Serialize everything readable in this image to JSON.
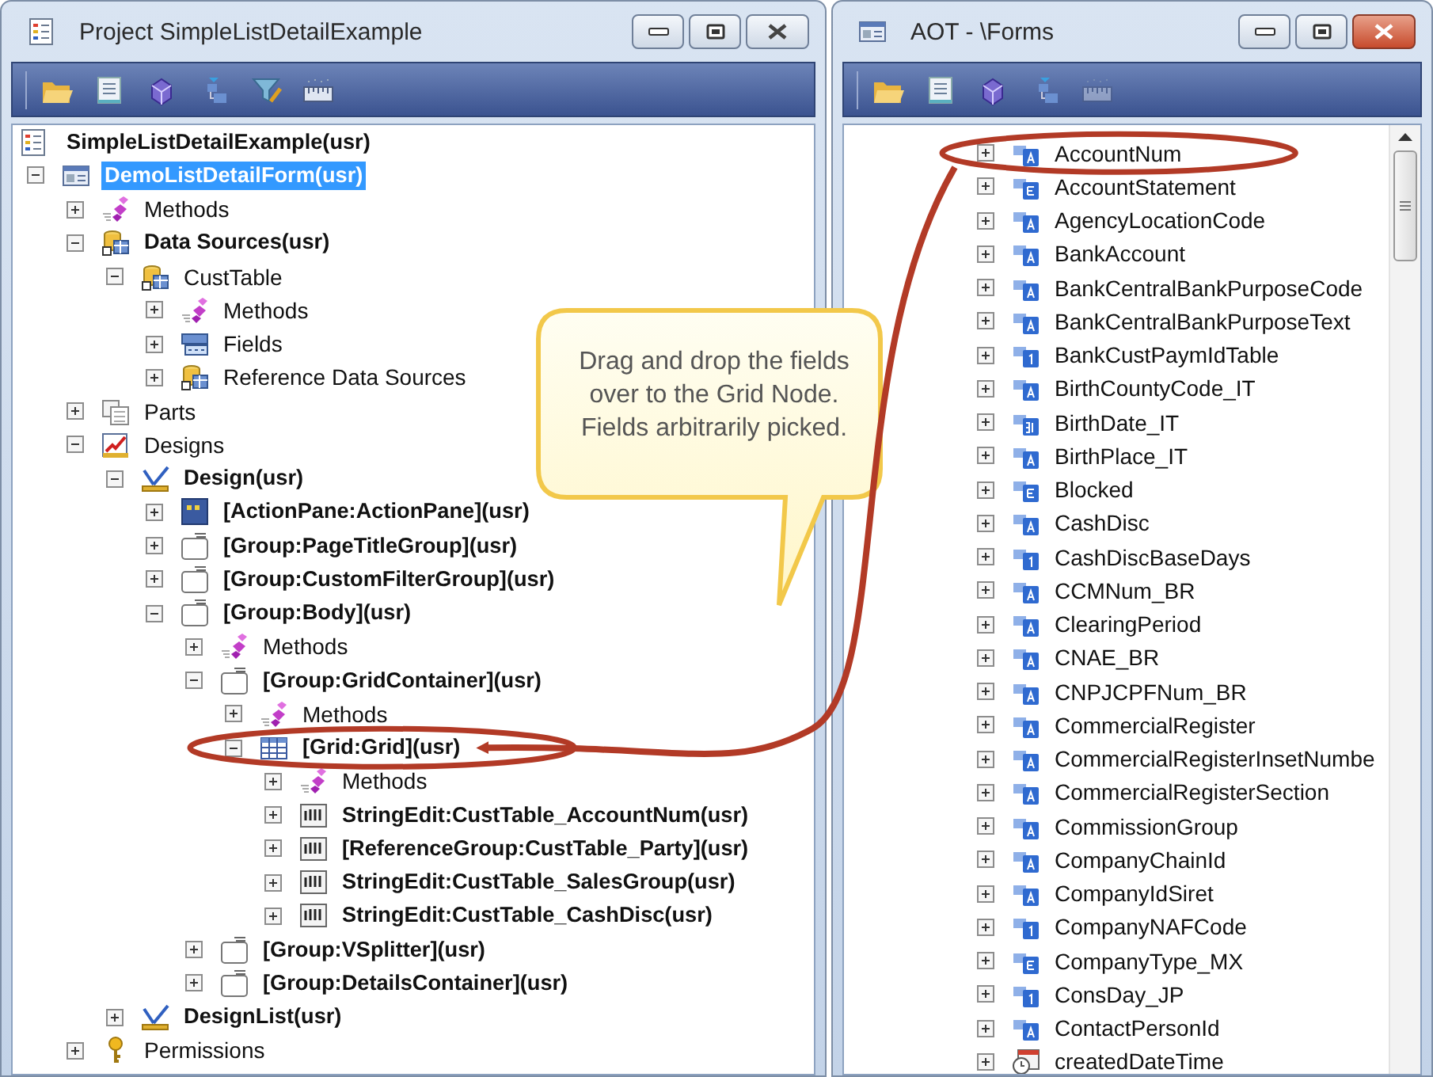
{
  "windows": [
    {
      "kind": "project",
      "title": "Project SimpleListDetailExample",
      "active": false,
      "toolbar": [
        {
          "kind": "open",
          "disabled": false
        },
        {
          "kind": "properties",
          "disabled": false
        },
        {
          "kind": "compile",
          "disabled": false
        },
        {
          "kind": "tree",
          "disabled": false
        },
        {
          "kind": "filter",
          "disabled": false
        },
        {
          "kind": "grid",
          "disabled": false
        }
      ],
      "tree": [
        {
          "text": "SimpleListDetailExample(usr)",
          "kind": "project",
          "bold": true,
          "selected": false,
          "highlighted": false,
          "children": [
            {
              "text": "DemoListDetailForm(usr)",
              "kind": "form",
              "bold": true,
              "expanded": true,
              "selected": true,
              "highlighted": false,
              "children": [
                {
                  "text": "Methods",
                  "kind": "methods",
                  "bold": false,
                  "expanded": false,
                  "selected": false,
                  "highlighted": false
                },
                {
                  "text": "Data Sources(usr)",
                  "kind": "datasources",
                  "bold": true,
                  "expanded": true,
                  "selected": false,
                  "highlighted": false,
                  "children": [
                    {
                      "text": "CustTable",
                      "kind": "datasource",
                      "bold": false,
                      "expanded": true,
                      "selected": false,
                      "highlighted": false,
                      "children": [
                        {
                          "text": "Methods",
                          "kind": "methods",
                          "bold": false,
                          "expanded": false,
                          "selected": false,
                          "highlighted": false
                        },
                        {
                          "text": "Fields",
                          "kind": "fields",
                          "bold": false,
                          "expanded": false,
                          "selected": false,
                          "highlighted": false
                        },
                        {
                          "text": "Reference Data Sources",
                          "kind": "datasources",
                          "bold": false,
                          "expanded": false,
                          "selected": false,
                          "highlighted": false
                        }
                      ]
                    }
                  ]
                },
                {
                  "text": "Parts",
                  "kind": "parts",
                  "bold": false,
                  "expanded": false,
                  "selected": false,
                  "highlighted": false
                },
                {
                  "text": "Designs",
                  "kind": "designs",
                  "bold": false,
                  "expanded": true,
                  "selected": false,
                  "highlighted": false,
                  "children": [
                    {
                      "text": "Design(usr)",
                      "kind": "design",
                      "bold": true,
                      "expanded": true,
                      "selected": false,
                      "highlighted": false,
                      "children": [
                        {
                          "text": "[ActionPane:ActionPane](usr)",
                          "kind": "actionpane",
                          "bold": true,
                          "expanded": false,
                          "selected": false,
                          "highlighted": false
                        },
                        {
                          "text": "[Group:PageTitleGroup](usr)",
                          "kind": "group",
                          "bold": true,
                          "expanded": false,
                          "selected": false,
                          "highlighted": false
                        },
                        {
                          "text": "[Group:CustomFilterGroup](usr)",
                          "kind": "group",
                          "bold": true,
                          "expanded": false,
                          "selected": false,
                          "highlighted": false
                        },
                        {
                          "text": "[Group:Body](usr)",
                          "kind": "group",
                          "bold": true,
                          "expanded": true,
                          "selected": false,
                          "highlighted": false,
                          "children": [
                            {
                              "text": "Methods",
                              "kind": "methods",
                              "bold": false,
                              "expanded": false,
                              "selected": false,
                              "highlighted": false
                            },
                            {
                              "text": "[Group:GridContainer](usr)",
                              "kind": "group",
                              "bold": true,
                              "expanded": true,
                              "selected": false,
                              "highlighted": false,
                              "children": [
                                {
                                  "text": "Methods",
                                  "kind": "methods",
                                  "bold": false,
                                  "expanded": false,
                                  "selected": false,
                                  "highlighted": false
                                },
                                {
                                  "text": "[Grid:Grid](usr)",
                                  "kind": "grid",
                                  "bold": true,
                                  "expanded": true,
                                  "selected": false,
                                  "highlighted": true,
                                  "children": [
                                    {
                                      "text": "Methods",
                                      "kind": "methods",
                                      "bold": false,
                                      "expanded": false,
                                      "selected": false,
                                      "highlighted": false
                                    },
                                    {
                                      "text": "StringEdit:CustTable_AccountNum(usr)",
                                      "kind": "stringedit",
                                      "bold": true,
                                      "expanded": false,
                                      "selected": false,
                                      "highlighted": false
                                    },
                                    {
                                      "text": "[ReferenceGroup:CustTable_Party](usr)",
                                      "kind": "stringedit",
                                      "bold": true,
                                      "expanded": false,
                                      "selected": false,
                                      "highlighted": false
                                    },
                                    {
                                      "text": "StringEdit:CustTable_SalesGroup(usr)",
                                      "kind": "stringedit",
                                      "bold": true,
                                      "expanded": false,
                                      "selected": false,
                                      "highlighted": false
                                    },
                                    {
                                      "text": "StringEdit:CustTable_CashDisc(usr)",
                                      "kind": "stringedit",
                                      "bold": true,
                                      "expanded": false,
                                      "selected": false,
                                      "highlighted": false
                                    }
                                  ]
                                }
                              ]
                            },
                            {
                              "text": "[Group:VSplitter](usr)",
                              "kind": "group",
                              "bold": true,
                              "expanded": false,
                              "selected": false,
                              "highlighted": false
                            },
                            {
                              "text": "[Group:DetailsContainer](usr)",
                              "kind": "group",
                              "bold": true,
                              "expanded": false,
                              "selected": false,
                              "highlighted": false
                            }
                          ]
                        }
                      ]
                    },
                    {
                      "text": "DesignList(usr)",
                      "kind": "design",
                      "bold": true,
                      "expanded": false,
                      "selected": false,
                      "highlighted": false
                    }
                  ]
                },
                {
                  "text": "Permissions",
                  "kind": "permissions",
                  "bold": false,
                  "expanded": false,
                  "selected": false,
                  "highlighted": false
                }
              ]
            }
          ]
        }
      ]
    },
    {
      "kind": "aot",
      "title": "AOT - \\Forms",
      "active": true,
      "toolbar": [
        {
          "kind": "open",
          "disabled": false
        },
        {
          "kind": "properties",
          "disabled": false
        },
        {
          "kind": "compile",
          "disabled": false
        },
        {
          "kind": "tree",
          "disabled": false
        },
        {
          "kind": "grid",
          "disabled": true
        }
      ],
      "tree": [
        {
          "text": "AccountNum",
          "kind": "string",
          "bold": false,
          "expanded": false,
          "selected": false,
          "highlighted": true
        },
        {
          "text": "AccountStatement",
          "kind": "enum",
          "bold": false,
          "expanded": false,
          "selected": false,
          "highlighted": false
        },
        {
          "text": "AgencyLocationCode",
          "kind": "string",
          "bold": false,
          "expanded": false,
          "selected": false,
          "highlighted": false
        },
        {
          "text": "BankAccount",
          "kind": "string",
          "bold": false,
          "expanded": false,
          "selected": false,
          "highlighted": false
        },
        {
          "text": "BankCentralBankPurposeCode",
          "kind": "string",
          "bold": false,
          "expanded": false,
          "selected": false,
          "highlighted": false
        },
        {
          "text": "BankCentralBankPurposeText",
          "kind": "string",
          "bold": false,
          "expanded": false,
          "selected": false,
          "highlighted": false
        },
        {
          "text": "BankCustPaymIdTable",
          "kind": "int",
          "bold": false,
          "expanded": false,
          "selected": false,
          "highlighted": false
        },
        {
          "text": "BirthCountyCode_IT",
          "kind": "string",
          "bold": false,
          "expanded": false,
          "selected": false,
          "highlighted": false
        },
        {
          "text": "BirthDate_IT",
          "kind": "date",
          "bold": false,
          "expanded": false,
          "selected": false,
          "highlighted": false
        },
        {
          "text": "BirthPlace_IT",
          "kind": "string",
          "bold": false,
          "expanded": false,
          "selected": false,
          "highlighted": false
        },
        {
          "text": "Blocked",
          "kind": "enum",
          "bold": false,
          "expanded": false,
          "selected": false,
          "highlighted": false
        },
        {
          "text": "CashDisc",
          "kind": "string",
          "bold": false,
          "expanded": false,
          "selected": false,
          "highlighted": false
        },
        {
          "text": "CashDiscBaseDays",
          "kind": "int",
          "bold": false,
          "expanded": false,
          "selected": false,
          "highlighted": false
        },
        {
          "text": "CCMNum_BR",
          "kind": "string",
          "bold": false,
          "expanded": false,
          "selected": false,
          "highlighted": false
        },
        {
          "text": "ClearingPeriod",
          "kind": "string",
          "bold": false,
          "expanded": false,
          "selected": false,
          "highlighted": false
        },
        {
          "text": "CNAE_BR",
          "kind": "string",
          "bold": false,
          "expanded": false,
          "selected": false,
          "highlighted": false
        },
        {
          "text": "CNPJCPFNum_BR",
          "kind": "string",
          "bold": false,
          "expanded": false,
          "selected": false,
          "highlighted": false
        },
        {
          "text": "CommercialRegister",
          "kind": "string",
          "bold": false,
          "expanded": false,
          "selected": false,
          "highlighted": false
        },
        {
          "text": "CommercialRegisterInsetNumbe",
          "kind": "string",
          "bold": false,
          "expanded": false,
          "selected": false,
          "highlighted": false
        },
        {
          "text": "CommercialRegisterSection",
          "kind": "string",
          "bold": false,
          "expanded": false,
          "selected": false,
          "highlighted": false
        },
        {
          "text": "CommissionGroup",
          "kind": "string",
          "bold": false,
          "expanded": false,
          "selected": false,
          "highlighted": false
        },
        {
          "text": "CompanyChainId",
          "kind": "string",
          "bold": false,
          "expanded": false,
          "selected": false,
          "highlighted": false
        },
        {
          "text": "CompanyIdSiret",
          "kind": "string",
          "bold": false,
          "expanded": false,
          "selected": false,
          "highlighted": false
        },
        {
          "text": "CompanyNAFCode",
          "kind": "int",
          "bold": false,
          "expanded": false,
          "selected": false,
          "highlighted": false
        },
        {
          "text": "CompanyType_MX",
          "kind": "enum",
          "bold": false,
          "expanded": false,
          "selected": false,
          "highlighted": false
        },
        {
          "text": "ConsDay_JP",
          "kind": "int",
          "bold": false,
          "expanded": false,
          "selected": false,
          "highlighted": false
        },
        {
          "text": "ContactPersonId",
          "kind": "string",
          "bold": false,
          "expanded": false,
          "selected": false,
          "highlighted": false
        },
        {
          "text": "createdDateTime",
          "kind": "datetime",
          "bold": false,
          "expanded": false,
          "selected": false,
          "highlighted": false
        }
      ]
    }
  ],
  "callout": {
    "text": "Drag and drop the fields over to the Grid Node. Fields arbitrarily picked."
  }
}
